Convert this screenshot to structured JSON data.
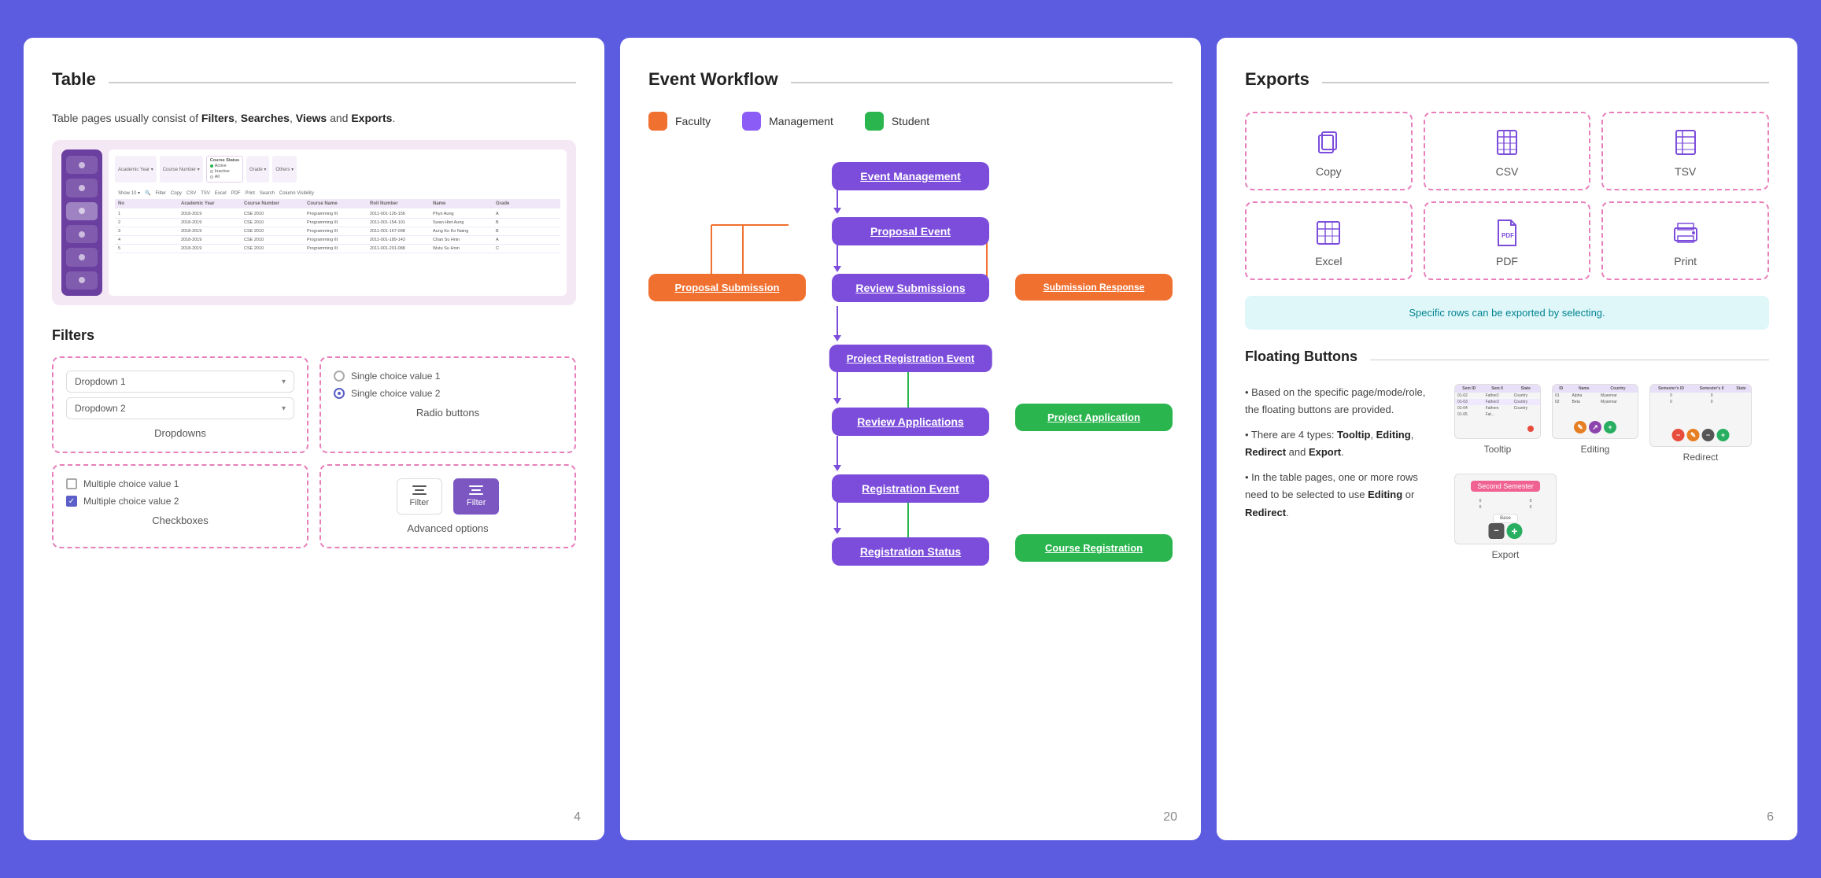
{
  "page1": {
    "title": "Table",
    "line_position": "after-title",
    "intro": "Table pages usually consist of",
    "bold_terms": [
      "Filters",
      "Searches",
      "Views",
      "Exports"
    ],
    "intro_end": ".",
    "filter_section": "Filters",
    "dropdowns": {
      "label": "Dropdowns",
      "item1": "Dropdown 1",
      "item2": "Dropdown 2"
    },
    "radio": {
      "label": "Radio buttons",
      "item1": "Single choice value 1",
      "item2": "Single choice value 2"
    },
    "checkboxes": {
      "label": "Checkboxes",
      "item1": "Multiple choice value 1",
      "item2": "Multiple choice value 2"
    },
    "advanced": {
      "label": "Advanced options",
      "btn1": "Filter",
      "btn2": "Filter"
    },
    "page_number": "4"
  },
  "page2": {
    "title": "Event Workflow",
    "legend": {
      "faculty_label": "Faculty",
      "management_label": "Management",
      "student_label": "Student"
    },
    "nodes": {
      "event_management": "Event Management",
      "proposal_event": "Proposal Event",
      "proposal_submission": "Proposal Submission",
      "review_submissions": "Review Submissions",
      "submission_response": "Submission Response",
      "project_registration_event": "Project Registration Event",
      "project_application": "Project Application",
      "review_applications": "Review Applications",
      "registration_event": "Registration Event",
      "course_registration": "Course Registration",
      "registration_status": "Registration Status"
    },
    "page_number": "20"
  },
  "page3": {
    "title": "Exports",
    "exports": [
      {
        "label": "Copy",
        "icon": "copy"
      },
      {
        "label": "CSV",
        "icon": "csv"
      },
      {
        "label": "TSV",
        "icon": "tsv"
      },
      {
        "label": "Excel",
        "icon": "excel"
      },
      {
        "label": "PDF",
        "icon": "pdf"
      },
      {
        "label": "Print",
        "icon": "print"
      }
    ],
    "export_note": "Specific rows can be exported by selecting.",
    "floating_title": "Floating Buttons",
    "floating_desc": [
      "• Based on the specific page/mode/role, the floating buttons are provided.",
      "• There are 4 types: Tooltip, Editing, Redirect and Export.",
      "• In the table pages, one or more rows need to be selected to use Editing or Redirect."
    ],
    "floating_examples": {
      "tooltip_label": "Tooltip",
      "editing_label": "Editing",
      "redirect_label": "Redirect",
      "export_label": "Export",
      "second_semester": "Second Semester"
    },
    "page_number": "6"
  }
}
